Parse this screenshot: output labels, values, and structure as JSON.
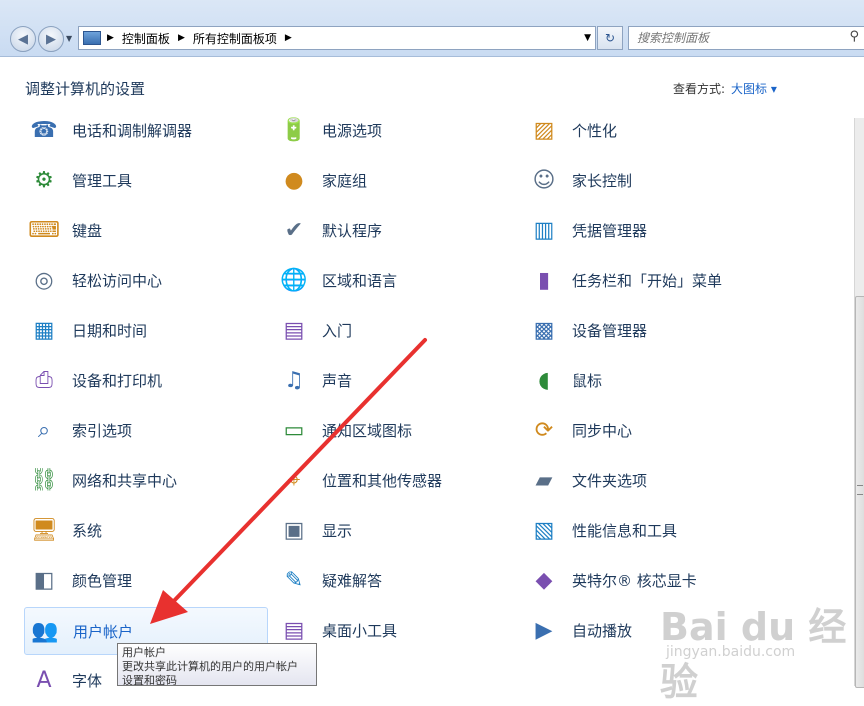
{
  "window": {
    "controls": [
      "–",
      "□",
      "✕"
    ]
  },
  "address": {
    "crumbs": [
      "控制面板",
      "所有控制面板项"
    ],
    "search_placeholder": "搜索控制面板"
  },
  "header": {
    "title": "调整计算机的设置",
    "view_by_label": "查看方式:",
    "view_by_value": "大图标 ▾"
  },
  "items": {
    "c0": [
      "电话和调制解调器",
      "管理工具",
      "键盘",
      "轻松访问中心",
      "日期和时间",
      "设备和打印机",
      "索引选项",
      "网络和共享中心",
      "系统",
      "颜色管理",
      "用户帐户",
      "字体"
    ],
    "c1": [
      "电源选项",
      "家庭组",
      "默认程序",
      "区域和语言",
      "入门",
      "声音",
      "通知区域图标",
      "位置和其他传感器",
      "显示",
      "疑难解答",
      "桌面小工具"
    ],
    "c2": [
      "个性化",
      "家长控制",
      "凭据管理器",
      "任务栏和「开始」菜单",
      "设备管理器",
      "鼠标",
      "同步中心",
      "文件夹选项",
      "性能信息和工具",
      "英特尔® 核芯显卡",
      "自动播放"
    ]
  },
  "icons": {
    "c0": [
      "phone-modem-icon",
      "admin-tools-icon",
      "keyboard-icon",
      "ease-of-access-icon",
      "date-time-icon",
      "devices-printers-icon",
      "indexing-icon",
      "network-sharing-icon",
      "system-icon",
      "color-management-icon",
      "user-accounts-icon",
      "fonts-icon"
    ],
    "c1": [
      "power-options-icon",
      "homegroup-icon",
      "default-programs-icon",
      "region-language-icon",
      "getting-started-icon",
      "sound-icon",
      "notification-icons-icon",
      "location-sensors-icon",
      "display-icon",
      "troubleshooting-icon",
      "desktop-gadgets-icon"
    ],
    "c2": [
      "personalization-icon",
      "parental-controls-icon",
      "credential-manager-icon",
      "taskbar-start-icon",
      "device-manager-icon",
      "mouse-icon",
      "sync-center-icon",
      "folder-options-icon",
      "performance-tools-icon",
      "intel-graphics-icon",
      "autoplay-icon"
    ]
  },
  "tooltip": {
    "line1": "用户帐户",
    "line2": "更改共享此计算机的用户的用户帐户",
    "line3": "设置和密码"
  },
  "watermark": {
    "big": "Bai du 经验",
    "small": "jingyan.baidu.com"
  },
  "colors": {
    "link": "#1a64c8",
    "text": "#1e395b",
    "arrow": "#e8312f"
  }
}
